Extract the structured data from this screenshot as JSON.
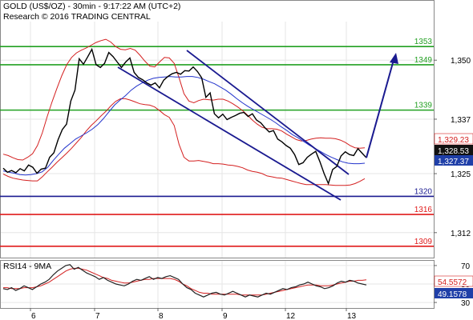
{
  "header": {
    "title": "GOLD (US$/OZ) - 30min - 9:17:22 AM (UTC+2)",
    "copyright": "Research © 2016 TRADING CENTRAL"
  },
  "colors": {
    "price": "#000000",
    "bollinger": "#d42020",
    "moving_average": "#2233cc",
    "resistance": "#22a022",
    "support_blue": "#1a1a90",
    "support_red": "#e01b1b",
    "channel": "#1a1a90",
    "forecast_arrow": "#1a1a90",
    "rsi": "#222222",
    "rsi_ma": "#d42020",
    "grid": "#e6e6e6",
    "frame": "#888888"
  },
  "chart_data": [
    {
      "type": "line",
      "title": "GOLD (US$/OZ) - 30min - 9:17:22 AM (UTC+2)",
      "x_ticks": [
        "6",
        "7",
        "8",
        "9",
        "12",
        "13"
      ],
      "y_ticks": [
        "1,350",
        "1,337",
        "1,325",
        "1,312"
      ],
      "ylim": [
        1306.5,
        1358.5
      ],
      "horizontal_levels": [
        {
          "label": "1353",
          "value": 1353,
          "color": "#22a022"
        },
        {
          "label": "1349",
          "value": 1349,
          "color": "#22a022"
        },
        {
          "label": "1339",
          "value": 1339,
          "color": "#22a022"
        },
        {
          "label": "1320",
          "value": 1320,
          "color": "#1a1a90"
        },
        {
          "label": "1316",
          "value": 1316,
          "color": "#e01b1b"
        },
        {
          "label": "1309",
          "value": 1309,
          "color": "#e01b1b"
        }
      ],
      "price_tags": [
        {
          "label": "1,329.23",
          "value": 1329.23,
          "style": "plain"
        },
        {
          "label": "1,328.53",
          "value": 1328.53,
          "style": "dark"
        },
        {
          "label": "1,327.37",
          "value": 1327.37,
          "style": "blue"
        }
      ],
      "series": [
        {
          "values": [
            1326.2,
            1325.3,
            1325.7,
            1325.2,
            1326.1,
            1325.6,
            1326.9,
            1326.4,
            1325.1,
            1326.0,
            1326.2,
            1328.6,
            1329.6,
            1332.5,
            1334.7,
            1335.9,
            1341.0,
            1343.4,
            1350.3,
            1349.1,
            1350.7,
            1352.4,
            1349.0,
            1348.4,
            1349.3,
            1351.7,
            1350.8,
            1349.6,
            1348.4,
            1349.6,
            1350.5,
            1347.3,
            1346.2,
            1345.7,
            1345.0,
            1344.5,
            1345.0,
            1343.9,
            1345.6,
            1346.4,
            1347.0,
            1347.3,
            1346.9,
            1347.7,
            1347.6,
            1348.5,
            1347.5,
            1346.1,
            1341.8,
            1342.8,
            1338.2,
            1337.3,
            1338.1,
            1336.9,
            1337.4,
            1337.8,
            1338.3,
            1338.5,
            1337.6,
            1338.2,
            1336.8,
            1336.2,
            1335.1,
            1334.2,
            1334.5,
            1332.6,
            1332.0,
            1331.2,
            1330.6,
            1329.2,
            1327.0,
            1327.4,
            1328.6,
            1329.3,
            1329.9,
            1327.6,
            1325.0,
            1322.8,
            1325.9,
            1326.6,
            1328.9,
            1329.8,
            1329.2,
            1329.0,
            1330.5,
            1329.5,
            1328.5
          ]
        },
        {
          "values": [
            1329.3,
            1329.0,
            1328.5,
            1328.1,
            1328.0,
            1328.6,
            1329.4,
            1331.2,
            1334.0,
            1337.6,
            1340.8,
            1343.8,
            1346.6,
            1349.0,
            1350.6,
            1351.6,
            1352.2,
            1352.7,
            1353.3,
            1353.9,
            1354.3,
            1354.6,
            1354.0,
            1353.0,
            1352.4,
            1352.3,
            1352.6,
            1352.2,
            1351.1,
            1349.8,
            1348.7,
            1348.5,
            1349.6,
            1350.6,
            1350.5,
            1349.3,
            1346.1,
            1342.6,
            1341.0,
            1340.6,
            1341.1,
            1341.4,
            1341.3,
            1341.2,
            1341.4,
            1341.4,
            1341.0,
            1340.4,
            1339.7,
            1338.9,
            1337.9,
            1336.8,
            1335.9,
            1335.2,
            1334.9,
            1334.9,
            1334.8,
            1334.4,
            1333.7,
            1333.1,
            1332.5,
            1332.2,
            1332.3,
            1332.6,
            1332.8,
            1332.9,
            1332.8,
            1332.8,
            1332.7,
            1332.4,
            1331.9,
            1331.2,
            1330.7,
            1330.6,
            1330.7
          ]
        },
        {
          "values": [
            1324.9,
            1324.4,
            1324.0,
            1323.8,
            1323.6,
            1323.5,
            1323.4,
            1323.4,
            1324.3,
            1325.4,
            1326.4,
            1327.5,
            1328.5,
            1329.5,
            1330.6,
            1331.8,
            1333.0,
            1334.4,
            1335.6,
            1336.6,
            1337.7,
            1338.7,
            1339.9,
            1340.9,
            1341.5,
            1341.5,
            1341.2,
            1340.8,
            1340.4,
            1340.2,
            1340.1,
            1339.7,
            1338.9,
            1338.0,
            1337.4,
            1335.6,
            1331.4,
            1328.6,
            1327.8,
            1327.8,
            1327.9,
            1327.7,
            1327.5,
            1327.2,
            1327.2,
            1327.1,
            1326.9,
            1326.8,
            1326.6,
            1326.3,
            1325.8,
            1325.5,
            1325.3,
            1325.0,
            1324.5,
            1324.3,
            1324.1,
            1324.0,
            1323.7,
            1323.4,
            1323.1,
            1322.8,
            1322.6,
            1322.6,
            1322.6,
            1322.6,
            1322.6,
            1322.5,
            1322.4,
            1322.4,
            1322.4,
            1322.5,
            1322.8,
            1323.3,
            1323.9
          ]
        },
        {
          "values": [
            1325.6,
            1325.3,
            1325.1,
            1324.8,
            1324.7,
            1324.8,
            1325.0,
            1325.4,
            1326.4,
            1327.9,
            1329.3,
            1330.6,
            1331.6,
            1332.6,
            1333.3,
            1334.0,
            1334.8,
            1335.8,
            1337.1,
            1338.6,
            1340.1,
            1341.2,
            1342.2,
            1343.4,
            1344.3,
            1345.0,
            1345.6,
            1346.0,
            1346.2,
            1346.3,
            1346.4,
            1346.3,
            1346.3,
            1346.4,
            1346.4,
            1346.2,
            1345.8,
            1345.3,
            1344.8,
            1344.1,
            1343.4,
            1342.5,
            1341.5,
            1340.6,
            1339.8,
            1339.1,
            1338.4,
            1337.7,
            1337.0,
            1336.2,
            1335.3,
            1334.5,
            1333.6,
            1332.9,
            1332.1,
            1331.3,
            1330.6,
            1329.9,
            1329.2,
            1328.6,
            1328.1,
            1327.6,
            1327.3,
            1327.2,
            1327.2,
            1327.3
          ]
        }
      ]
    },
    {
      "type": "line",
      "title": "RSI14 - 9MA",
      "x_ticks": [
        "6",
        "7",
        "8",
        "9",
        "12",
        "13"
      ],
      "y_ticks": [
        "70",
        "50",
        "30"
      ],
      "ylim": [
        24,
        76
      ],
      "value_tags": [
        {
          "label": "54.5572",
          "value": 54.5572,
          "color": "#d42020"
        },
        {
          "label": "49.1578",
          "value": 49.1578,
          "color": "#1a1a90"
        }
      ],
      "series": [
        {
          "values": [
            45,
            44,
            46,
            43,
            45,
            48,
            46,
            44,
            47,
            50,
            52,
            55,
            60,
            64,
            67,
            70,
            71,
            66,
            68,
            65,
            62,
            60,
            58,
            55,
            57,
            54,
            52,
            50,
            49,
            48,
            50,
            53,
            55,
            54,
            56,
            58,
            55,
            57,
            56,
            58,
            59,
            57,
            55,
            50,
            46,
            44,
            40,
            38,
            36,
            38,
            40,
            41,
            39,
            38,
            40,
            42,
            40,
            38,
            36,
            38,
            37,
            36,
            38,
            40,
            39,
            41,
            43,
            45,
            44,
            46,
            47,
            49,
            50,
            52,
            50,
            48,
            47,
            45,
            46,
            48,
            51,
            53,
            52,
            54,
            53,
            51,
            50,
            49
          ]
        },
        {
          "values": [
            46,
            46,
            45,
            45,
            45,
            46,
            46,
            46,
            47,
            48,
            50,
            52,
            55,
            58,
            61,
            64,
            66,
            67,
            67,
            66,
            65,
            63,
            61,
            59,
            57,
            56,
            54,
            53,
            52,
            51,
            51,
            52,
            53,
            54,
            55,
            55,
            56,
            56,
            56,
            56,
            56,
            55,
            53,
            50,
            48,
            45,
            43,
            41,
            40,
            40,
            39,
            39,
            39,
            39,
            39,
            39,
            39,
            38,
            38,
            38,
            38,
            38,
            38,
            39,
            40,
            41,
            42,
            43,
            44,
            45,
            46,
            47,
            48,
            49,
            49,
            49,
            48,
            48,
            48,
            49,
            50,
            51,
            52,
            53,
            53,
            54,
            54,
            54.6
          ]
        }
      ]
    }
  ]
}
